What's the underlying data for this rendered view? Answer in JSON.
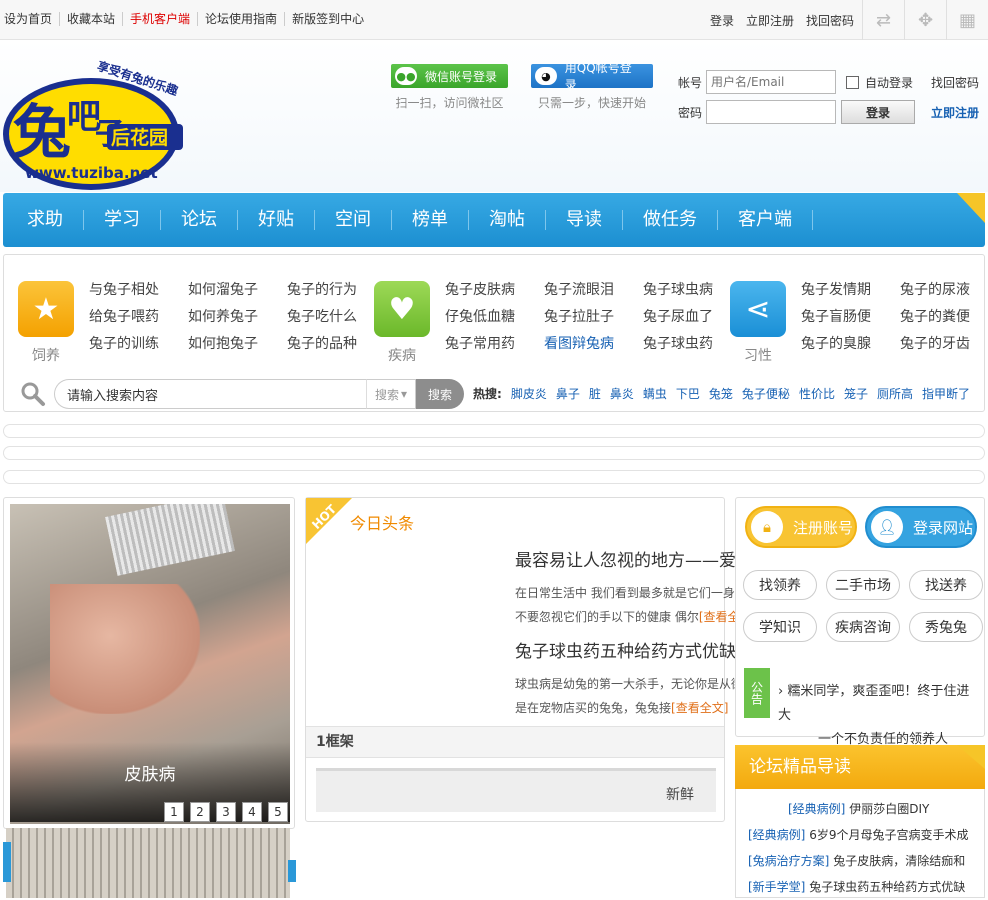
{
  "top": {
    "links": [
      "设为首页",
      "收藏本站",
      "手机客户端",
      "论坛使用指南",
      "新版签到中心"
    ],
    "right": [
      "登录",
      "立即注册",
      "找回密码"
    ]
  },
  "header": {
    "wechat_label": "微信账号登录",
    "wechat_sub": "扫一扫，访问微社区",
    "qq_label": "用QQ帐号登录",
    "qq_sub": "只需一步，快速开始",
    "login": {
      "account_label": "帐号",
      "account_placeholder": "用户名/Email",
      "auto_login": "自动登录",
      "find_password": "找回密码",
      "password_label": "密码",
      "login_button": "登录",
      "register": "立即注册"
    }
  },
  "nav": [
    "求助",
    "学习",
    "论坛",
    "好贴",
    "空间",
    "榜单",
    "淘帖",
    "导读",
    "做任务",
    "客户端"
  ],
  "categories": [
    {
      "label": "饲养",
      "links": [
        "与兔子相处",
        "如何溜兔子",
        "兔子的行为",
        "给兔子喂药",
        "如何养兔子",
        "兔子吃什么",
        "兔子的训练",
        "如何抱兔子",
        "兔子的品种"
      ]
    },
    {
      "label": "疾病",
      "links": [
        "兔子皮肤病",
        "兔子流眼泪",
        "兔子球虫病",
        "仔兔低血糖",
        "兔子拉肚子",
        "兔子尿血了",
        "兔子常用药",
        "看图辩兔病",
        "兔子球虫药"
      ]
    },
    {
      "label": "习性",
      "links": [
        "兔子发情期",
        "兔子的尿液",
        "兔子盲肠便",
        "兔子的粪便",
        "兔子的臭腺",
        "兔子的牙齿"
      ]
    }
  ],
  "search": {
    "placeholder": "请输入搜索内容",
    "select": "搜索",
    "button": "搜索",
    "hot_label": "热搜:",
    "hot": [
      "脚皮炎",
      "鼻子",
      "脏",
      "鼻炎",
      "螨虫",
      "下巴",
      "兔笼",
      "兔子便秘",
      "性价比",
      "笼子",
      "厕所高",
      "指甲断了"
    ]
  },
  "slider": {
    "caption": "皮肤病",
    "pages": [
      "1",
      "2",
      "3",
      "4",
      "5"
    ]
  },
  "news": {
    "badge": "HOT",
    "header": "今日头条",
    "articles": [
      {
        "title": "最容易让人忽视的地方——爱宠儿",
        "summary": "在日常生活中 我们看到最多就是它们一身绒绒的毛 从来不要忽视它们的手以下的健康 偶尔",
        "more": "[查看全文]"
      },
      {
        "title": "兔子球虫药五种给药方式优缺点解析",
        "summary": "球虫病是幼兔的第一大杀手，无论你是从街边买的兔兔还是在宠物店买的兔兔，兔兔接",
        "more": "[查看全文]"
      }
    ],
    "frame_title": "1框架",
    "frame_tab": "新鲜"
  },
  "side": {
    "register": "注册账号",
    "login": "登录网站",
    "tags": [
      "找领养",
      "二手市场",
      "找送养",
      "学知识",
      "疾病咨询",
      "秀兔兔"
    ],
    "notice_label": "公告",
    "notice": [
      "糯米同学，爽歪歪吧！终于住进大",
      "一个不负责任的领养人"
    ]
  },
  "forum": {
    "title": "论坛精品导读",
    "items": [
      {
        "tag": "[经典病例]",
        "text": "伊丽莎白圈DIY"
      },
      {
        "tag": "[经典病例]",
        "text": "6岁9个月母兔子宫病变手术成"
      },
      {
        "tag": "[兔病治疗方案]",
        "text": "兔子皮肤病，清除结痂和"
      },
      {
        "tag": "[新手学堂]",
        "text": "兔子球虫药五种给药方式优缺"
      }
    ]
  }
}
